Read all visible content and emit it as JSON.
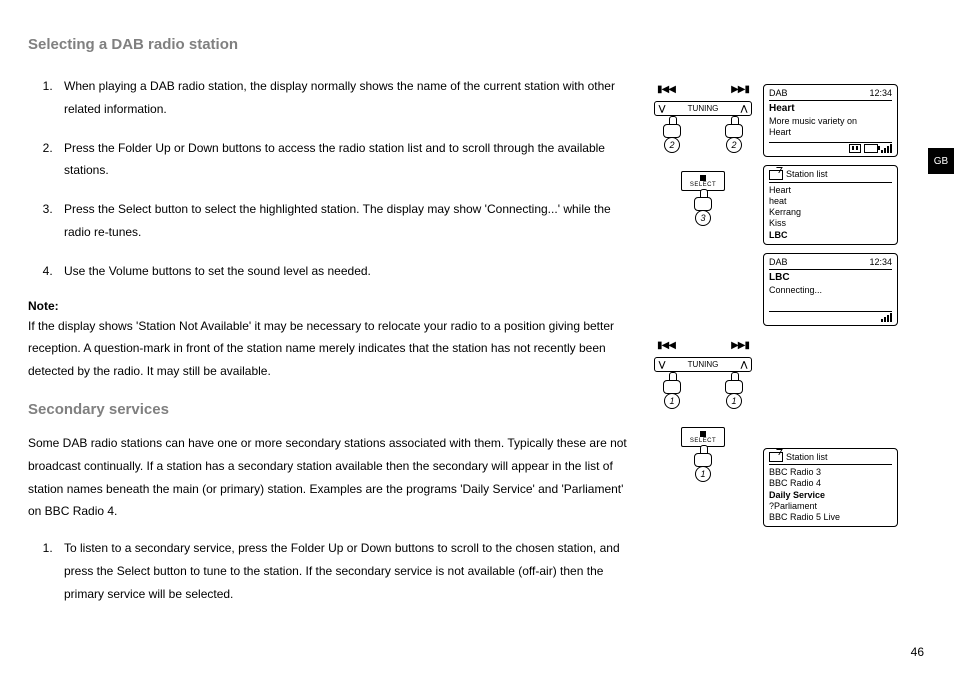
{
  "page_number": "46",
  "language_tab": "GB",
  "section1": {
    "title": "Selecting a DAB radio station",
    "steps": [
      "When playing a DAB radio station, the display normally shows the name of the current station with other related information.",
      "Press the Folder Up or Down buttons to access the radio station list and to scroll through the available stations.",
      "Press the Select button to select the highlighted station. The display may show 'Connecting...' while the radio re-tunes.",
      "Use the Volume buttons to set the sound level as needed."
    ],
    "note_label": "Note:",
    "note_body": "If the display shows 'Station Not Available' it may be necessary to relocate your radio to a position giving better reception. A question-mark in front of the station name merely indicates that the station has not recently been detected by the radio. It may still be available."
  },
  "section2": {
    "title": "Secondary services",
    "intro": "Some DAB radio stations can have one or more secondary stations associated with them. Typically these are not broadcast continually. If a station has a secondary station available then the secondary will appear in the list of station names beneath the main (or primary) station. Examples are the programs 'Daily Service' and 'Parliament' on BBC Radio 4.",
    "steps": [
      "To listen to a secondary service, press the Folder Up or Down buttons to scroll to the chosen station, and press the Select button to tune to the station. If the secondary service is not available (off-air) then the primary service will be selected."
    ]
  },
  "controls": {
    "tuning_label": "TUNING",
    "select_label": "SELECT",
    "fig1_step_left": "2",
    "fig1_step_right": "2",
    "fig1_step_select": "3",
    "fig2_step_left": "1",
    "fig2_step_right": "1",
    "fig2_step_select": "1"
  },
  "screens": {
    "s1": {
      "mode": "DAB",
      "time": "12:34",
      "title": "Heart",
      "line1": "More music variety on",
      "line2": "Heart"
    },
    "s2": {
      "header": "Station list",
      "items": [
        "Heart",
        "heat",
        "Kerrang",
        "Kiss",
        "LBC"
      ],
      "bold_index": 4
    },
    "s3": {
      "mode": "DAB",
      "time": "12:34",
      "title": "LBC",
      "line1": "Connecting..."
    },
    "s4": {
      "header": "Station list",
      "items": [
        "BBC Radio 3",
        "BBC Radio 4",
        "Daily Service",
        "?Parliament",
        "BBC Radio 5 Live"
      ],
      "bold_index": 2
    }
  }
}
